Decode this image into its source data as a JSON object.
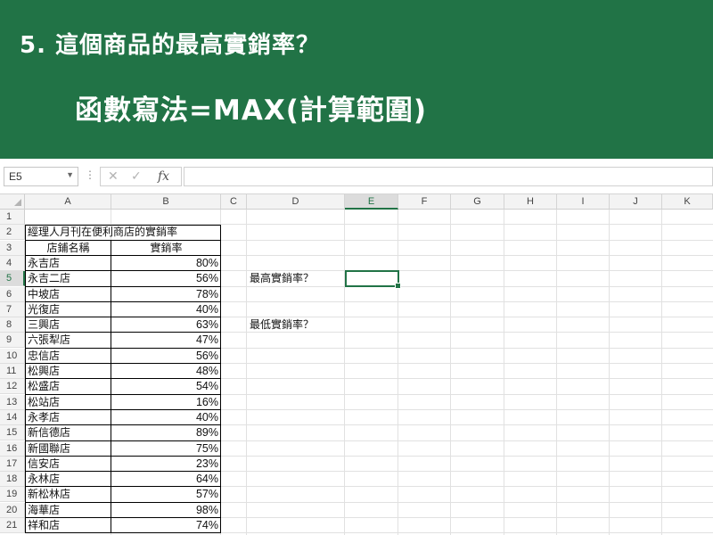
{
  "banner": {
    "question": "5. 這個商品的最高實銷率？",
    "formula": "函數寫法=MAX(計算範圍)",
    "color": "#217346"
  },
  "formula_bar": {
    "name_box": "E5",
    "cancel_icon": "✕",
    "enter_icon": "✓",
    "fx_label": "fx",
    "formula_value": ""
  },
  "columns": [
    "A",
    "B",
    "C",
    "D",
    "E",
    "F",
    "G",
    "H",
    "I",
    "J",
    "K"
  ],
  "selected_cell": "E5",
  "rows": [
    "1",
    "2",
    "3",
    "4",
    "5",
    "6",
    "7",
    "8",
    "9",
    "10",
    "11",
    "12",
    "13",
    "14",
    "15",
    "16",
    "17",
    "18",
    "19",
    "20",
    "21"
  ],
  "sheet": {
    "title": "經理人月刊在便利商店的實銷率",
    "header_store": "店鋪名稱",
    "header_rate": "實銷率",
    "data": [
      {
        "store": "永吉店",
        "rate": "80%"
      },
      {
        "store": "永吉二店",
        "rate": "56%"
      },
      {
        "store": "中坡店",
        "rate": "78%"
      },
      {
        "store": "光復店",
        "rate": "40%"
      },
      {
        "store": "三興店",
        "rate": "63%"
      },
      {
        "store": "六張犁店",
        "rate": "47%"
      },
      {
        "store": "忠信店",
        "rate": "56%"
      },
      {
        "store": "松興店",
        "rate": "48%"
      },
      {
        "store": "松盛店",
        "rate": "54%"
      },
      {
        "store": "松站店",
        "rate": "16%"
      },
      {
        "store": "永孝店",
        "rate": "40%"
      },
      {
        "store": "新信德店",
        "rate": "89%"
      },
      {
        "store": "新國聯店",
        "rate": "75%"
      },
      {
        "store": "信安店",
        "rate": "23%"
      },
      {
        "store": "永林店",
        "rate": "64%"
      },
      {
        "store": "新松林店",
        "rate": "57%"
      },
      {
        "store": "海華店",
        "rate": "98%"
      },
      {
        "store": "祥和店",
        "rate": "74%"
      }
    ],
    "max_label": "最高實銷率？",
    "min_label": "最低實銷率？"
  }
}
